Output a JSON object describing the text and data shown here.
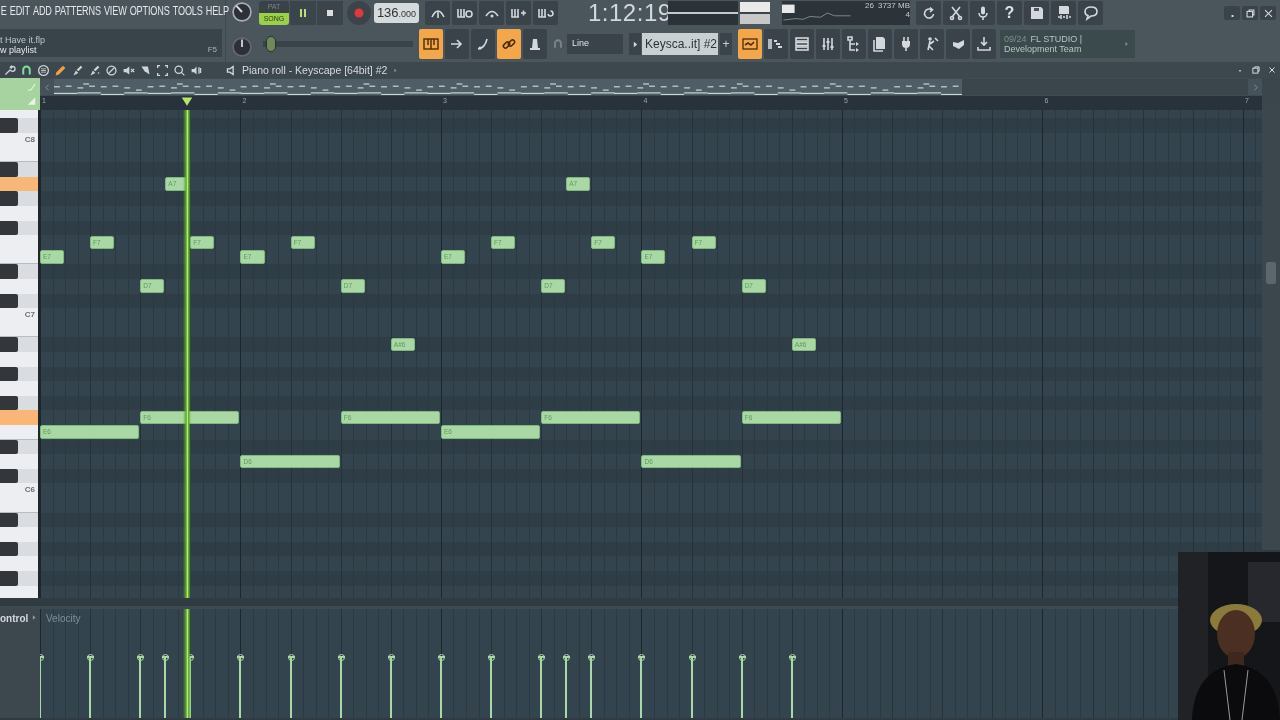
{
  "menu": {
    "items": [
      "E",
      "EDIT",
      "ADD",
      "PATTERNS",
      "VIEW",
      "OPTIONS",
      "TOOLS",
      "HELP"
    ]
  },
  "hint": {
    "line_1": "t Have it.flp",
    "line_2": "w playlist",
    "shortcut": "F5"
  },
  "transport": {
    "modes": [
      {
        "label": "PAT",
        "selected": false
      },
      {
        "label": "SONG",
        "selected": true
      }
    ],
    "playing": true,
    "tempo_whole": "136",
    "tempo_fraction": ".000"
  },
  "master_pitch": {
    "level": 0.02
  },
  "top_tools": [
    {
      "on": false
    },
    {
      "on": false
    },
    {
      "on": false
    },
    {
      "on": false
    },
    {
      "on": false
    }
  ],
  "time": "1:12:19",
  "monitor": {
    "cpu": "26",
    "memory": "3737 MB",
    "polyphony": "4"
  },
  "help": "?",
  "tools": [
    {
      "on": true
    },
    {
      "on": false
    },
    {
      "on": false
    },
    {
      "on": true
    },
    {
      "on": false
    }
  ],
  "snap": {
    "value": "Line"
  },
  "pattern": {
    "name": "Keysca..it] #2",
    "add": "+"
  },
  "windows": [
    {
      "on": true
    },
    {
      "on": false
    },
    {
      "on": false
    },
    {
      "on": false
    },
    {
      "on": false
    },
    {
      "on": false
    },
    {
      "on": false
    },
    {
      "on": false
    },
    {
      "on": false
    },
    {
      "on": false
    }
  ],
  "news": {
    "date": "09/24",
    "title": "FL STUDIO |",
    "subtitle": "Development Team"
  },
  "piano_roll": {
    "title": "Piano roll - Keyscape [64bit] #2",
    "ruler": [
      "1",
      "2",
      "3",
      "4",
      "5",
      "6",
      "7"
    ],
    "octaves": [
      "C8",
      "C7",
      "C6"
    ],
    "keys": [
      {
        "pressed": false
      },
      {
        "pressed": false
      },
      {
        "pressed": false
      },
      {
        "pressed": false
      },
      {
        "pressed": false
      },
      {
        "pressed": true
      },
      {
        "pressed": false
      },
      {
        "pressed": false
      },
      {
        "pressed": false
      },
      {
        "pressed": false
      },
      {
        "pressed": false
      },
      {
        "pressed": false
      },
      {
        "pressed": false
      },
      {
        "pressed": false
      },
      {
        "pressed": false
      },
      {
        "pressed": false
      },
      {
        "pressed": false
      },
      {
        "pressed": false
      },
      {
        "pressed": false
      },
      {
        "pressed": false
      },
      {
        "pressed": false
      },
      {
        "pressed": true
      },
      {
        "pressed": false
      },
      {
        "pressed": false
      },
      {
        "pressed": false
      },
      {
        "pressed": false
      },
      {
        "pressed": false
      },
      {
        "pressed": false
      },
      {
        "pressed": false
      },
      {
        "pressed": false
      },
      {
        "pressed": false
      },
      {
        "pressed": false
      },
      {
        "pressed": false
      },
      {
        "pressed": false
      }
    ],
    "notes": [
      {
        "label": "E7"
      },
      {
        "label": "F7"
      },
      {
        "label": "D7"
      },
      {
        "label": "A7"
      },
      {
        "label": "F7"
      },
      {
        "label": "E7"
      },
      {
        "label": "F7"
      },
      {
        "label": "D7"
      },
      {
        "label": "A#6"
      },
      {
        "label": "E7"
      },
      {
        "label": "F7"
      },
      {
        "label": "D7"
      },
      {
        "label": "A7"
      },
      {
        "label": "F7"
      },
      {
        "label": "E7"
      },
      {
        "label": "F7"
      },
      {
        "label": "D7"
      },
      {
        "label": "A#6"
      },
      {
        "label": "E6"
      },
      {
        "label": "F6"
      },
      {
        "label": "D6"
      },
      {
        "label": "F6"
      },
      {
        "label": "E6"
      },
      {
        "label": "F6"
      },
      {
        "label": "D6"
      },
      {
        "label": "F6"
      }
    ],
    "control": {
      "label": "ontrol",
      "parameter": "Velocity"
    }
  }
}
